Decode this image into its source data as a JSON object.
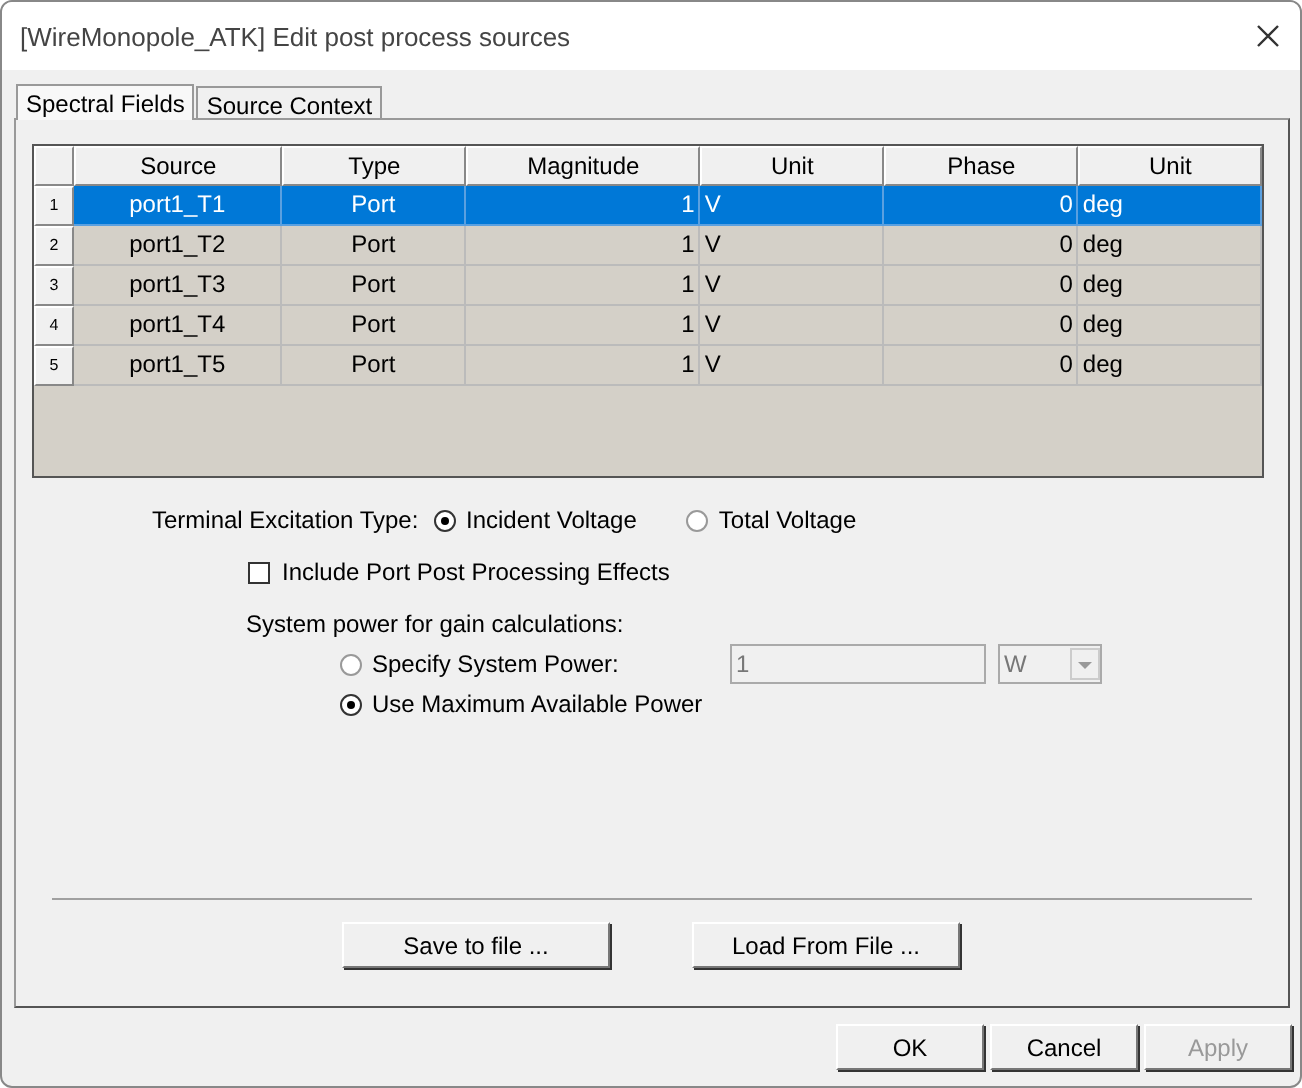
{
  "window": {
    "title": "[WireMonopole_ATK]  Edit post process sources"
  },
  "tabs": [
    {
      "label": "Spectral Fields",
      "selected": true
    },
    {
      "label": "Source Context",
      "selected": false
    }
  ],
  "table": {
    "columns": [
      "Source",
      "Type",
      "Magnitude",
      "Unit",
      "Phase",
      "Unit"
    ],
    "rows": [
      {
        "number": "1",
        "cells": [
          "port1_T1",
          "Port",
          "1",
          "V",
          "0",
          "deg"
        ],
        "selected": true
      },
      {
        "number": "2",
        "cells": [
          "port1_T2",
          "Port",
          "1",
          "V",
          "0",
          "deg"
        ],
        "selected": false
      },
      {
        "number": "3",
        "cells": [
          "port1_T3",
          "Port",
          "1",
          "V",
          "0",
          "deg"
        ],
        "selected": false
      },
      {
        "number": "4",
        "cells": [
          "port1_T4",
          "Port",
          "1",
          "V",
          "0",
          "deg"
        ],
        "selected": false
      },
      {
        "number": "5",
        "cells": [
          "port1_T5",
          "Port",
          "1",
          "V",
          "0",
          "deg"
        ],
        "selected": false
      }
    ]
  },
  "excitation": {
    "label": "Terminal Excitation Type:",
    "options": [
      {
        "label": "Incident Voltage",
        "selected": true
      },
      {
        "label": "Total Voltage",
        "selected": false
      }
    ]
  },
  "post_processing": {
    "label": "Include Port Post Processing Effects",
    "checked": false
  },
  "system_power": {
    "label": "System power for gain calculations:",
    "options": [
      {
        "label": "Specify System Power:",
        "selected": false
      },
      {
        "label": "Use Maximum Available Power",
        "selected": true
      }
    ],
    "value": "1",
    "unit": "W",
    "disabled": true
  },
  "file_buttons": [
    "Save to file ...",
    "Load From File ..."
  ],
  "buttons": [
    {
      "label": "OK",
      "disabled": false
    },
    {
      "label": "Cancel",
      "disabled": false
    },
    {
      "label": "Apply",
      "disabled": true
    }
  ]
}
